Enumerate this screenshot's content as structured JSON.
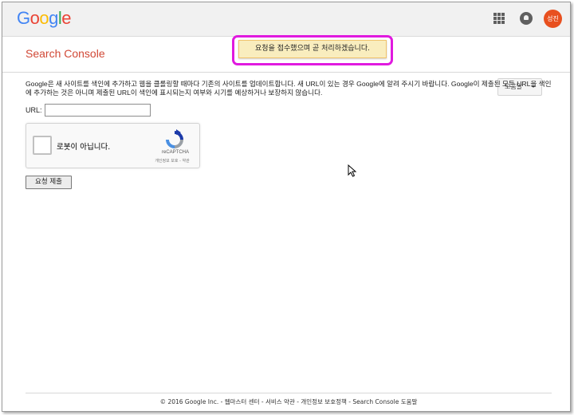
{
  "header": {
    "logo_letters": [
      {
        "ch": "G",
        "color": "#4285f4"
      },
      {
        "ch": "o",
        "color": "#ea4335"
      },
      {
        "ch": "o",
        "color": "#fbbc05"
      },
      {
        "ch": "g",
        "color": "#4285f4"
      },
      {
        "ch": "l",
        "color": "#34a853"
      },
      {
        "ch": "e",
        "color": "#ea4335"
      }
    ],
    "apps_icon": "apps-grid-icon",
    "notifications_icon": "bell-icon",
    "avatar_text": "성진",
    "avatar_color": "#e8501f"
  },
  "subheader": {
    "product_title": "Search Console",
    "toast_message": "요청을 접수했으며 곧 처리하겠습니다.",
    "help_label": "도움말"
  },
  "main": {
    "description": "Google은 새 사이트를 색인에 추가하고 웹을 클롤링할 때마다 기존의 사이트를 업데이트합니다. 새 URL이 있는 경우 Google에 알려 주시기 바랍니다. Google이 제출된 모든 URL을 색인에 추가하는 것은 아니며 제출된 URL이 색인에 표시되는지 여부와 시기를 예상하거나 보장하지 않습니다.",
    "url_label": "URL:",
    "url_value": "",
    "recaptcha": {
      "checkbox_label": "로봇이 아닙니다.",
      "brand": "reCAPTCHA",
      "links": "개인정보 보호 - 약관"
    },
    "submit_label": "요청 제출"
  },
  "footer": {
    "text": "© 2016 Google Inc. - 웹마스터 센터 - 서비스 약관 - 개인정보 보호정책 - Search Console 도움말"
  },
  "colors": {
    "toast_background": "#f9edbe",
    "highlight_border": "#e01adf",
    "product_title": "#d14836"
  }
}
